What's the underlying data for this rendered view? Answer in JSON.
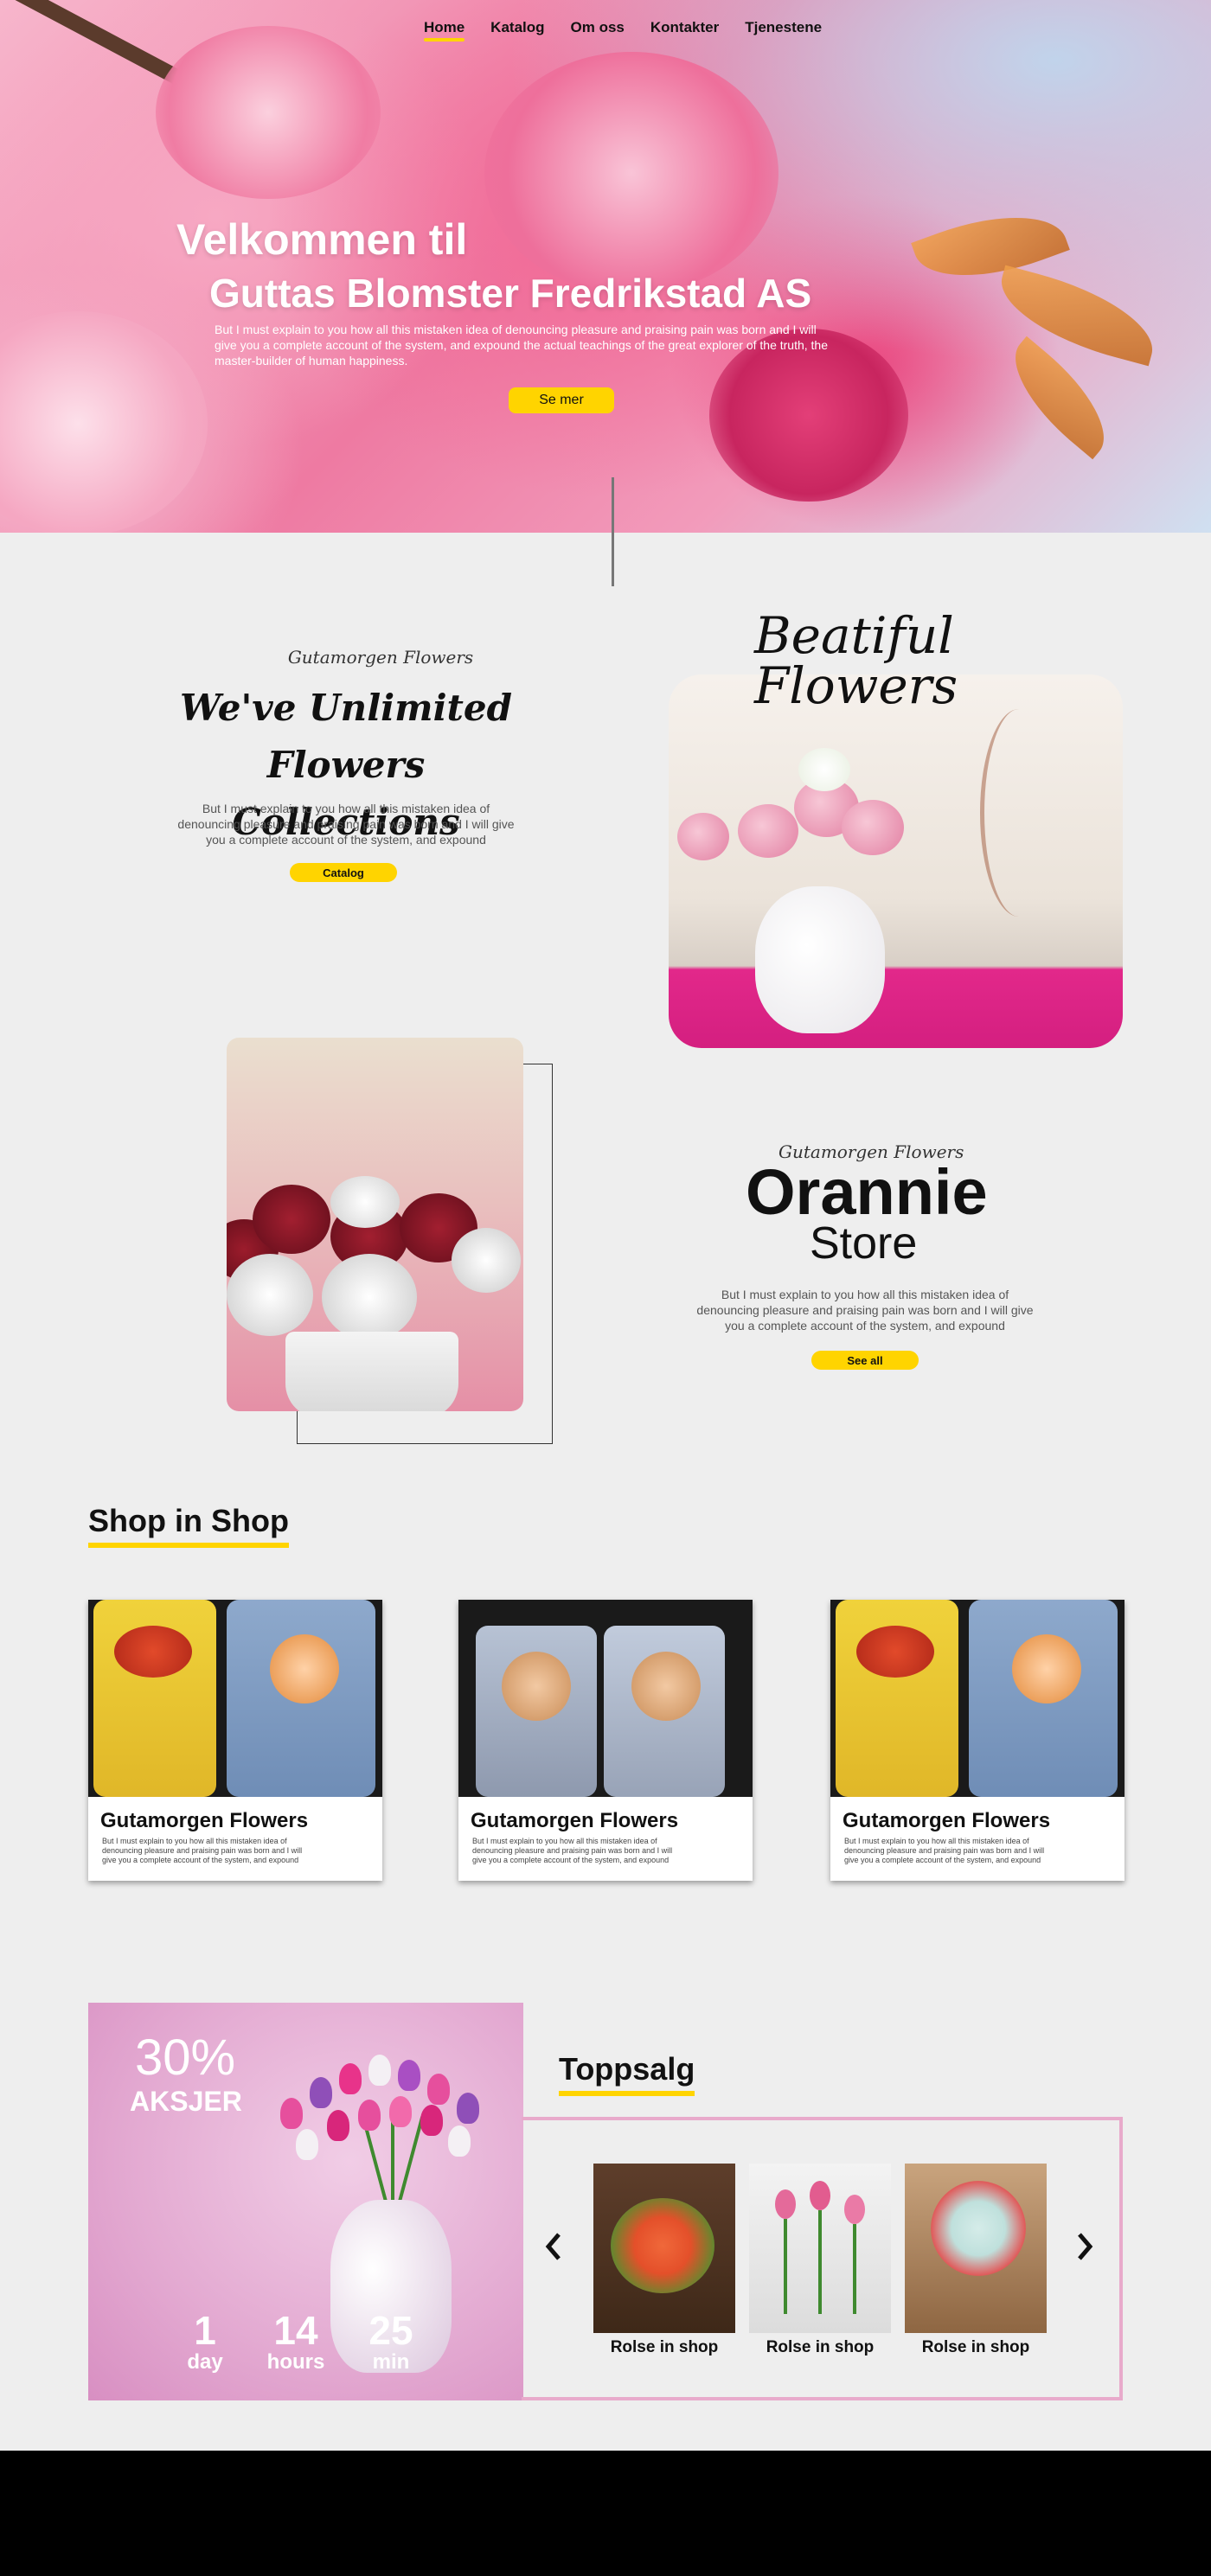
{
  "nav": {
    "items": [
      {
        "label": "Home",
        "active": true
      },
      {
        "label": "Katalog",
        "active": false
      },
      {
        "label": "Om oss",
        "active": false
      },
      {
        "label": "Kontakter",
        "active": false
      },
      {
        "label": "Tjenestene",
        "active": false
      }
    ]
  },
  "hero": {
    "title_line1": "Velkommen til",
    "title_line2": "Guttas Blomster Fredrikstad AS",
    "subtitle": "But I must explain to you how all this mistaken idea of denouncing pleasure and praising pain was born and I will give you a complete account of the system, and expound the actual teachings of the great explorer of the truth, the master-builder of human happiness.",
    "button_label": "Se mer"
  },
  "intro": {
    "script_small": "Gutamorgen Flowers",
    "heading_line1": "We've Unlimited Flowers",
    "heading_line2": "Collections",
    "paragraph": "But I must explain to you how all this mistaken idea of denouncing pleasure and praising pain was born and I will give you a complete account of the system, and expound",
    "button_label": "Catalog",
    "beautiful_line1": "Beatiful",
    "beautiful_line2": "Flowers"
  },
  "store": {
    "script_small": "Gutamorgen Flowers",
    "name": "Orannie",
    "subtitle": "Store",
    "paragraph": "But I must explain to you how all this mistaken idea of denouncing pleasure and praising pain was born and I will give you a complete account of the system, and expound",
    "button_label": "See all"
  },
  "shop": {
    "title": "Shop  in Shop",
    "cards": [
      {
        "title": "Gutamorgen Flowers",
        "text": "But I must explain to you how all this mistaken idea of denouncing pleasure and praising pain was born and I will give you a complete account of the system, and expound"
      },
      {
        "title": "Gutamorgen Flowers",
        "text": "But I must explain to you how all this mistaken idea of denouncing pleasure and praising pain was born and I will give you a complete account of the system, and expound"
      },
      {
        "title": "Gutamorgen Flowers",
        "text": "But I must explain to you how all this mistaken idea of denouncing pleasure and praising pain was born and I will give you a complete account of the system, and expound"
      }
    ]
  },
  "sale": {
    "percent": "30%",
    "label": "AKSJER",
    "countdown": [
      {
        "value": "1",
        "unit": "day"
      },
      {
        "value": "14",
        "unit": "hours"
      },
      {
        "value": "25",
        "unit": "min"
      }
    ]
  },
  "toppsalg": {
    "title": "Toppsalg",
    "prev_icon": "chevron-left-icon",
    "next_icon": "chevron-right-icon",
    "products": [
      {
        "label": "Rolse in shop"
      },
      {
        "label": "Rolse in shop"
      },
      {
        "label": "Rolse in shop"
      }
    ]
  },
  "colors": {
    "accent_yellow": "#ffd400",
    "pink_border": "#e8aacb",
    "background": "#eeeeee",
    "footer": "#000000"
  }
}
